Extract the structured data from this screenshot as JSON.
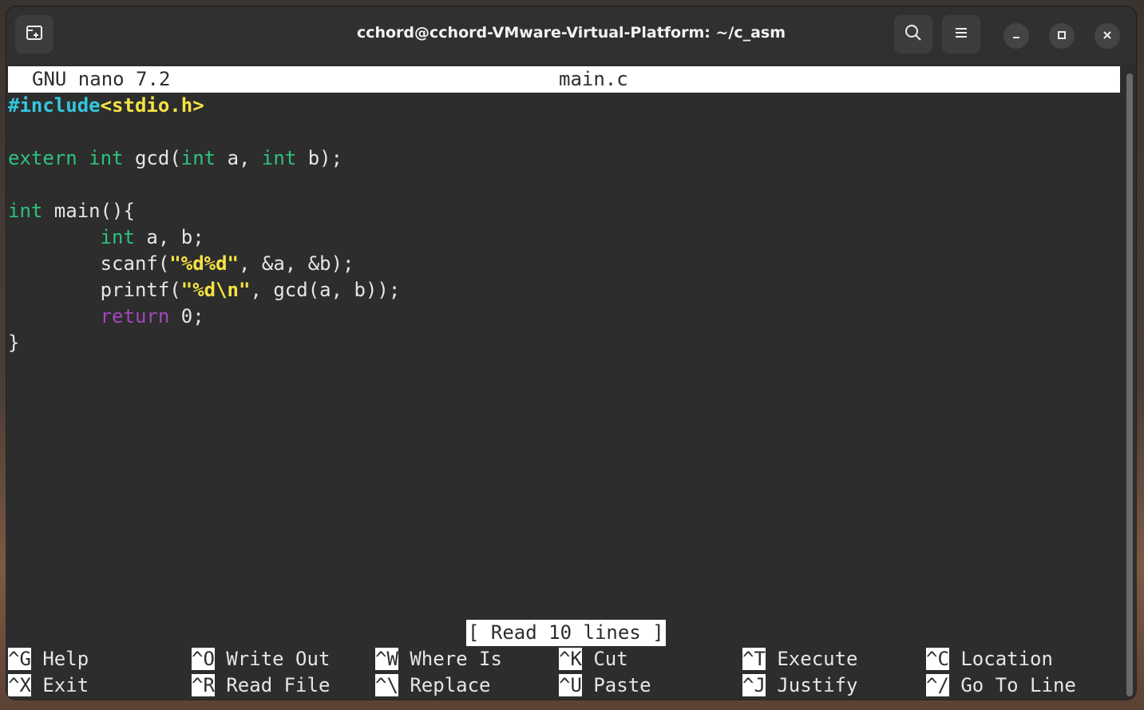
{
  "window": {
    "title": "cchord@cchord-VMware-Virtual-Platform: ~/c_asm"
  },
  "header": {
    "version": "GNU nano 7.2",
    "filename": "main.c"
  },
  "code": {
    "l1_include": "#include",
    "l1_header": "<stdio.h>",
    "l3_extern": "extern",
    "l3_int1": "int",
    "l3_gcd": " gcd(",
    "l3_int2": "int",
    "l3_a": " a, ",
    "l3_int3": "int",
    "l3_b": " b);",
    "l5_int": "int",
    "l5_main": " main(){",
    "l6_int": "int",
    "l6_rest": " a, b;",
    "l7_scanf": "scanf(",
    "l7_str": "\"%d%d\"",
    "l7_rest": ", &a, &b);",
    "l8_printf": "printf(",
    "l8_str": "\"%d\\n\"",
    "l8_rest": ", gcd(a, b));",
    "l9_return": "return",
    "l9_rest": " 0;",
    "l10_close": "}"
  },
  "status": "[ Read 10 lines ]",
  "shortcuts": [
    {
      "key": "^G",
      "label": "Help"
    },
    {
      "key": "^X",
      "label": "Exit"
    },
    {
      "key": "^O",
      "label": "Write Out"
    },
    {
      "key": "^R",
      "label": "Read File"
    },
    {
      "key": "^W",
      "label": "Where Is"
    },
    {
      "key": "^\\",
      "label": "Replace"
    },
    {
      "key": "^K",
      "label": "Cut"
    },
    {
      "key": "^U",
      "label": "Paste"
    },
    {
      "key": "^T",
      "label": "Execute"
    },
    {
      "key": "^J",
      "label": "Justify"
    },
    {
      "key": "^C",
      "label": "Location"
    },
    {
      "key": "^/",
      "label": "Go To Line"
    }
  ],
  "icons": {
    "new_tab": "new-tab-icon",
    "search": "search-icon",
    "menu": "hamburger-menu-icon",
    "minimize": "minimize-icon",
    "maximize": "maximize-icon",
    "close": "close-icon"
  }
}
